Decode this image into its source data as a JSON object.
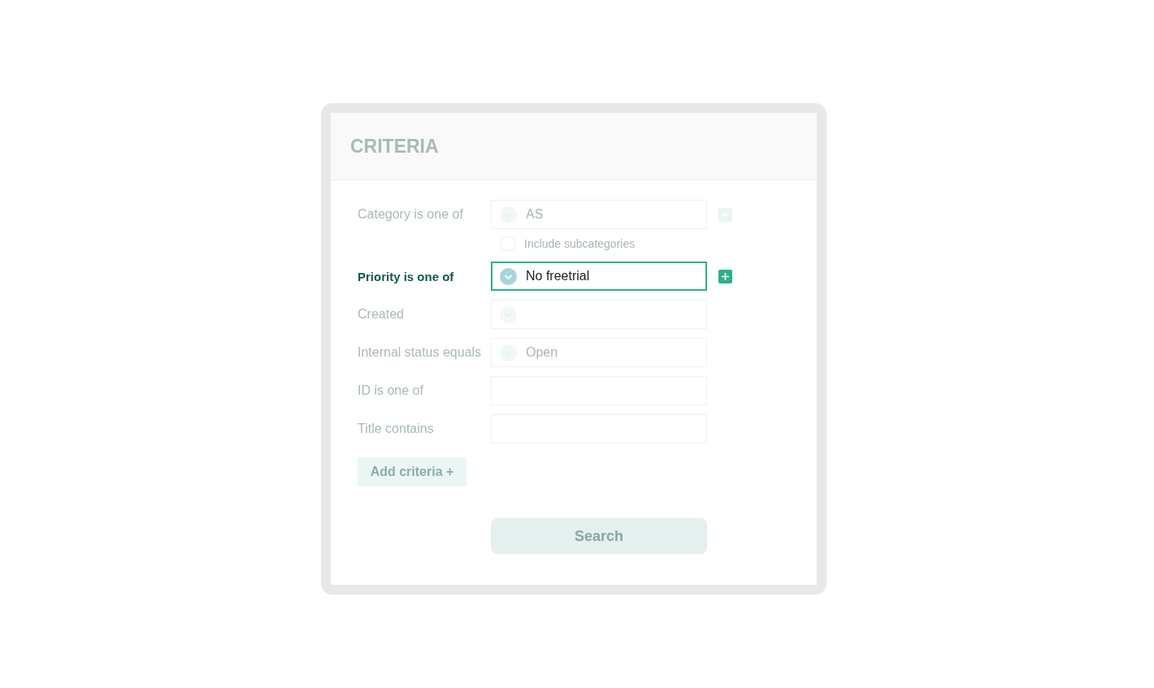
{
  "panel": {
    "title": "CRITERIA"
  },
  "criteria": [
    {
      "label": "Category is one of",
      "kind": "dropdown",
      "value": "AS",
      "highlighted": false,
      "add_button": true,
      "option": {
        "label": "Include subcategories",
        "checked": false
      }
    },
    {
      "label": "Priority is one of",
      "kind": "dropdown",
      "value": "No freetrial",
      "highlighted": true,
      "add_button": true
    },
    {
      "label": "Created",
      "kind": "dropdown",
      "highlighted": false,
      "add_button": false
    },
    {
      "label": "Internal status equals",
      "kind": "dropdown",
      "value": "Open",
      "highlighted": false,
      "add_button": false
    },
    {
      "label": "ID is one of",
      "kind": "text",
      "highlighted": false,
      "add_button": false
    },
    {
      "label": "Title contains",
      "kind": "text",
      "highlighted": false,
      "add_button": false
    }
  ],
  "add_criteria": {
    "label": "Add criteria +"
  },
  "search_button": {
    "label": "Search"
  }
}
